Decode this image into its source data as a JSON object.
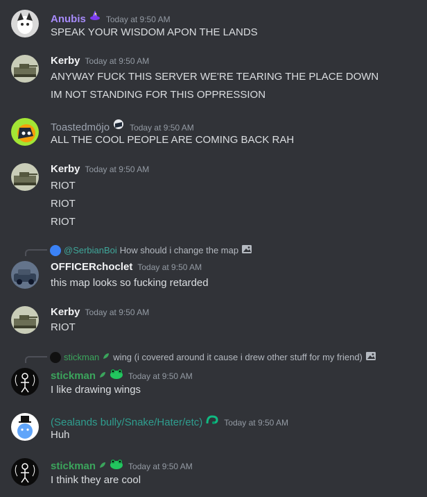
{
  "colors": {
    "background": "#313338",
    "anubis": "#a78bfa",
    "default_name": "#f2f3f5",
    "toasted": "#9ca3af",
    "green_name": "#3ba55c",
    "timestamp": "#949ba4",
    "reply_mention": "#3fa79a"
  },
  "messages": [
    {
      "username": "Anubis",
      "timestamp": "Today at 9:50 AM",
      "lines": [
        "SPEAK YOUR WISDOM APON THE LANDS"
      ]
    },
    {
      "username": "Kerby",
      "timestamp": "Today at 9:50 AM",
      "lines": [
        "ANYWAY FUCK THIS SERVER WE'RE TEARING THE PLACE DOWN",
        "IM NOT STANDING FOR THIS OPPRESSION"
      ]
    },
    {
      "username": "Toastedmöjo",
      "timestamp": "Today at 9:50 AM",
      "lines": [
        "ALL THE COOL PEOPLE ARE COMING BACK RAH"
      ]
    },
    {
      "username": "Kerby",
      "timestamp": "Today at 9:50 AM",
      "lines": [
        "RIOT",
        "RIOT",
        "RIOT"
      ]
    },
    {
      "reply_to": "@SerbianBoi",
      "reply_text": "How should i change the map",
      "username": "OFFICERchoclet",
      "timestamp": "Today at 9:50 AM",
      "lines": [
        "this map looks so fucking retarded"
      ]
    },
    {
      "username": "Kerby",
      "timestamp": "Today at 9:50 AM",
      "lines": [
        "RIOT"
      ]
    },
    {
      "reply_to": "stickman",
      "reply_text": "wing (i covered around it cause i drew other stuff for my friend)",
      "username": "stickman",
      "timestamp": "Today at 9:50 AM",
      "lines": [
        "I like drawing wings"
      ]
    },
    {
      "username": "(Sealands bully/Snake/Hater/etc)",
      "timestamp": "Today at 9:50 AM",
      "lines": [
        "Huh"
      ]
    },
    {
      "username": "stickman",
      "timestamp": "Today at 9:50 AM",
      "lines": [
        "I think they are cool"
      ]
    }
  ]
}
